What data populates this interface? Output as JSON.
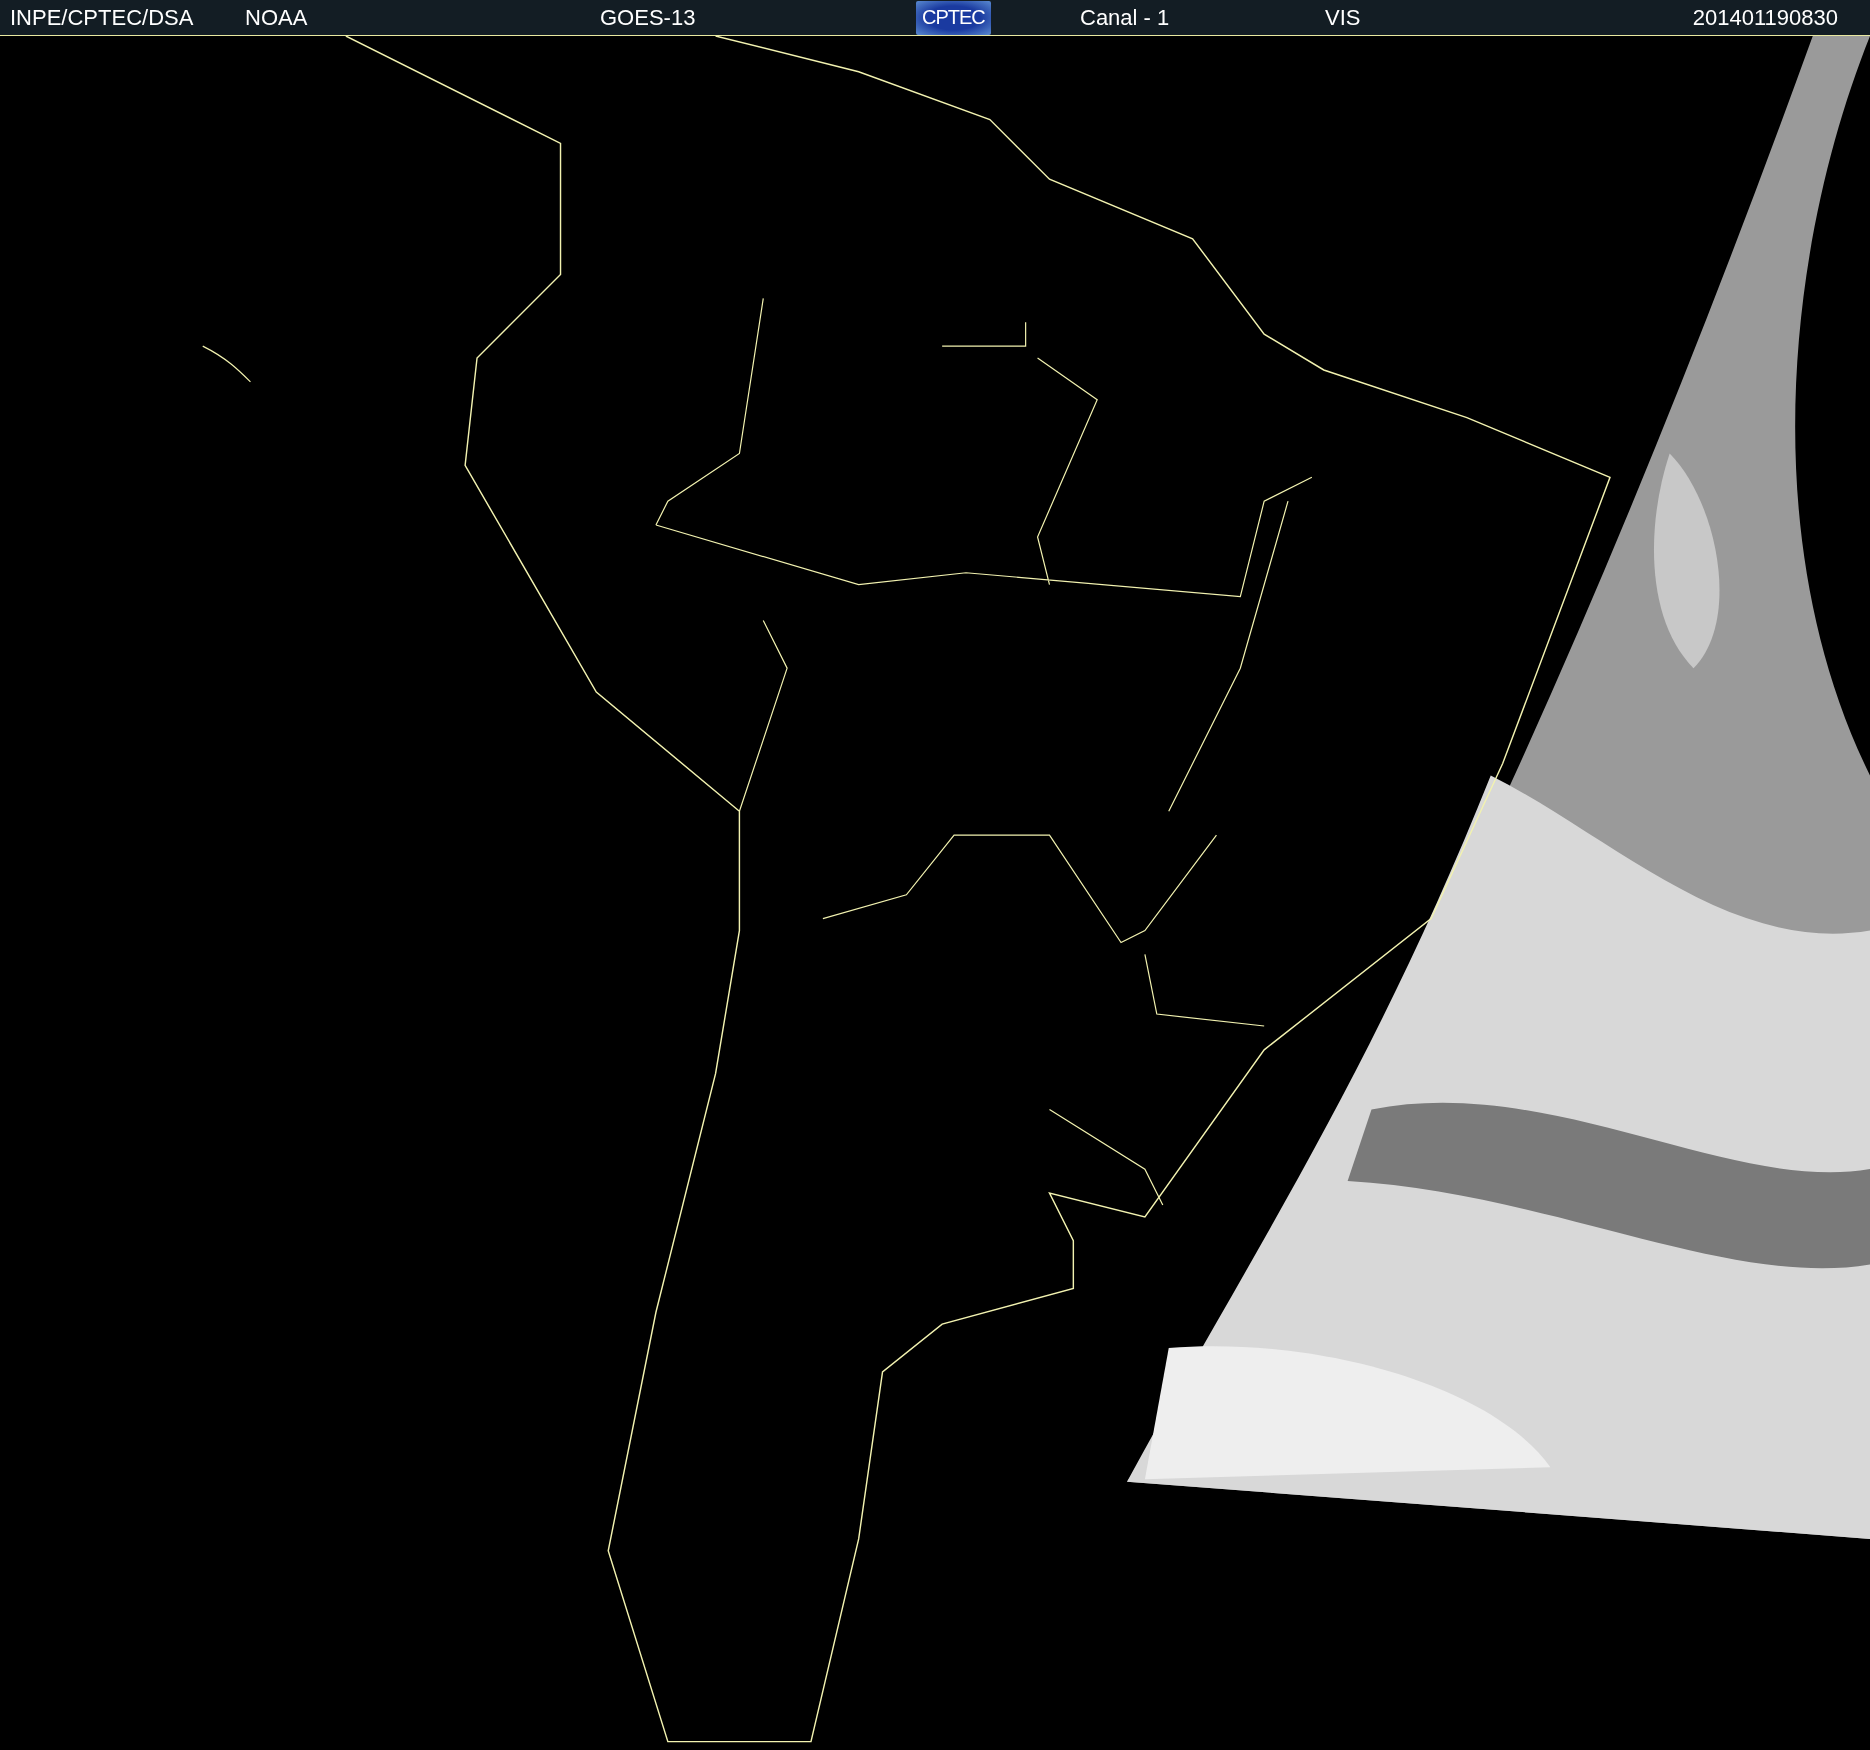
{
  "header": {
    "items": [
      {
        "kind": "text",
        "text": "INPE/CPTEC/DSA"
      },
      {
        "kind": "text",
        "text": "NOAA"
      },
      {
        "kind": "text",
        "text": "GOES-13"
      },
      {
        "kind": "logo",
        "text": "CPTEC"
      },
      {
        "kind": "text",
        "text": "Canal - 1"
      },
      {
        "kind": "text",
        "text": "VIS"
      },
      {
        "kind": "text",
        "text": "201401190830"
      }
    ]
  }
}
